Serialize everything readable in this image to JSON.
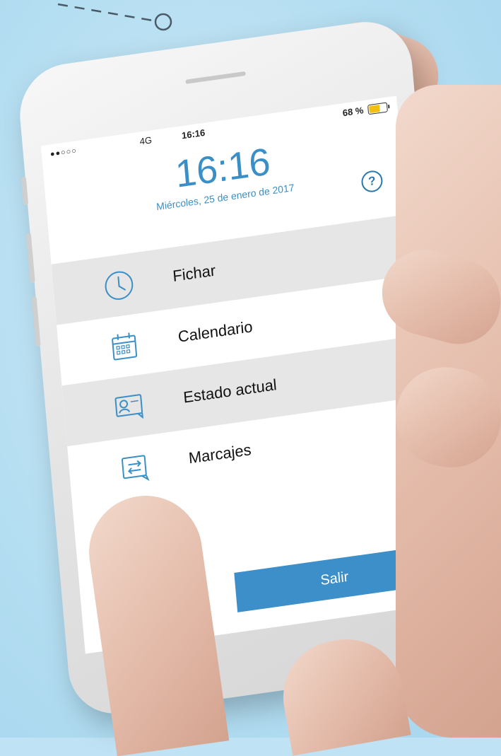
{
  "colors": {
    "accent": "#3b8fc7",
    "button": "#3d8fc9",
    "battery": "#f3c012",
    "row_shade": "#e6e6e6"
  },
  "statusbar": {
    "signal": "●●○○○",
    "carrier": "4G",
    "time": "16:16",
    "battery_pct": "68 %",
    "battery_level": 0.68
  },
  "clock": {
    "time": "16:16",
    "date": "Miércoles, 25 de enero de 2017"
  },
  "help": {
    "label": "?",
    "icon": "question-circle-icon"
  },
  "menu": {
    "items": [
      {
        "label": "Fichar",
        "icon": "clock-icon"
      },
      {
        "label": "Calendario",
        "icon": "calendar-icon"
      },
      {
        "label": "Estado actual",
        "icon": "user-status-icon"
      },
      {
        "label": "Marcajes",
        "icon": "swap-arrows-icon"
      }
    ]
  },
  "exit": {
    "label": "Salir"
  }
}
